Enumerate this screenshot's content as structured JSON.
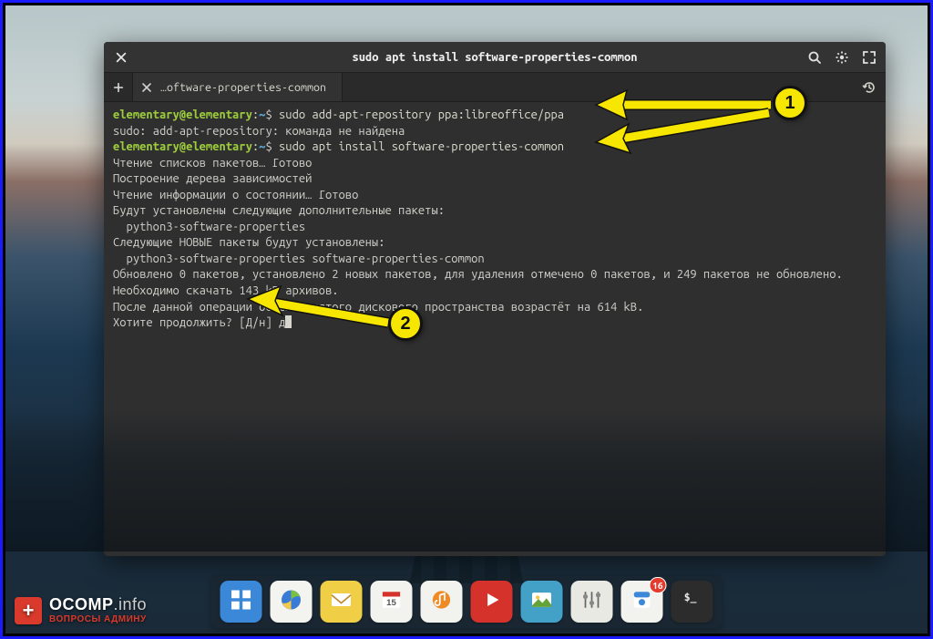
{
  "window": {
    "title": "sudo apt install software-properties-common"
  },
  "tabs": {
    "newtab_tooltip": "New Tab",
    "items": [
      {
        "title": "…oftware-properties-common"
      }
    ]
  },
  "terminal": {
    "prompt_user": "elementary@elementary",
    "prompt_path": "~",
    "lines": [
      {
        "type": "cmd",
        "text": "sudo add-apt-repository ppa:libreoffice/ppa"
      },
      {
        "type": "out",
        "text": "sudo: add-apt-repository: команда не найдена"
      },
      {
        "type": "cmd",
        "text": "sudo apt install software-properties-common"
      },
      {
        "type": "out",
        "text": "Чтение списков пакетов… Готово"
      },
      {
        "type": "out",
        "text": "Построение дерева зависимостей"
      },
      {
        "type": "out",
        "text": "Чтение информации о состоянии… Готово"
      },
      {
        "type": "out",
        "text": "Будут установлены следующие дополнительные пакеты:"
      },
      {
        "type": "out",
        "text": "  python3-software-properties"
      },
      {
        "type": "out",
        "text": "Следующие НОВЫЕ пакеты будут установлены:"
      },
      {
        "type": "out",
        "text": "  python3-software-properties software-properties-common"
      },
      {
        "type": "out",
        "text": "Обновлено 0 пакетов, установлено 2 новых пакетов, для удаления отмечено 0 пакетов, и 249 пакетов не обновлено."
      },
      {
        "type": "out",
        "text": "Необходимо скачать 143 kB архивов."
      },
      {
        "type": "out",
        "text": "После данной операции объём занятого дискового пространства возрастёт на 614 kB."
      },
      {
        "type": "out",
        "text": "Хотите продолжить? [Д/н] д"
      }
    ]
  },
  "dock": {
    "items": [
      {
        "name": "multitasking",
        "bg": "#3b87d8"
      },
      {
        "name": "web-browser",
        "bg": "#f3f3f0"
      },
      {
        "name": "mail",
        "bg": "#f0cf46"
      },
      {
        "name": "calendar",
        "bg": "#f2f2ee"
      },
      {
        "name": "music",
        "bg": "#f2f2ee"
      },
      {
        "name": "videos",
        "bg": "#d5322c"
      },
      {
        "name": "photos",
        "bg": "#43a1c8"
      },
      {
        "name": "switchboard",
        "bg": "#e9e9e4"
      },
      {
        "name": "appcenter",
        "bg": "#f2f2ee",
        "badge": "16"
      },
      {
        "name": "terminal",
        "bg": "#2c2c2c"
      }
    ]
  },
  "annotations": {
    "callout1": "1",
    "callout2": "2"
  },
  "watermark": {
    "brand": "OCOMP",
    "suffix": ".info",
    "tagline": "ВОПРОСЫ АДМИНУ"
  }
}
